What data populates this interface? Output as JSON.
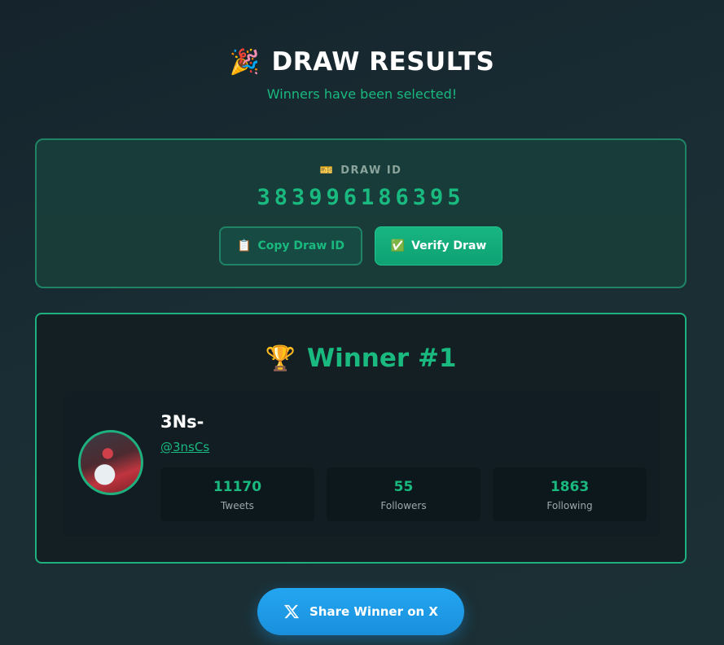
{
  "header": {
    "emoji": "🎉",
    "title": "DRAW RESULTS",
    "subtitle": "Winners have been selected!"
  },
  "draw": {
    "label_icon": "🎫",
    "label": "DRAW ID",
    "id": "383996186395",
    "copy_icon": "📋",
    "copy_label": "Copy Draw ID",
    "verify_icon": "✅",
    "verify_label": "Verify Draw"
  },
  "winner": {
    "trophy": "🏆",
    "title": "Winner #1",
    "name": "3Ns-",
    "handle": "@3nsCs",
    "stats": [
      {
        "value": "11170",
        "label": "Tweets"
      },
      {
        "value": "55",
        "label": "Followers"
      },
      {
        "value": "1863",
        "label": "Following"
      }
    ]
  },
  "share": {
    "label": "Share Winner on X",
    "icon": "x-logo-icon"
  },
  "colors": {
    "accent": "#19b97f",
    "share": "#1d9bf0"
  }
}
